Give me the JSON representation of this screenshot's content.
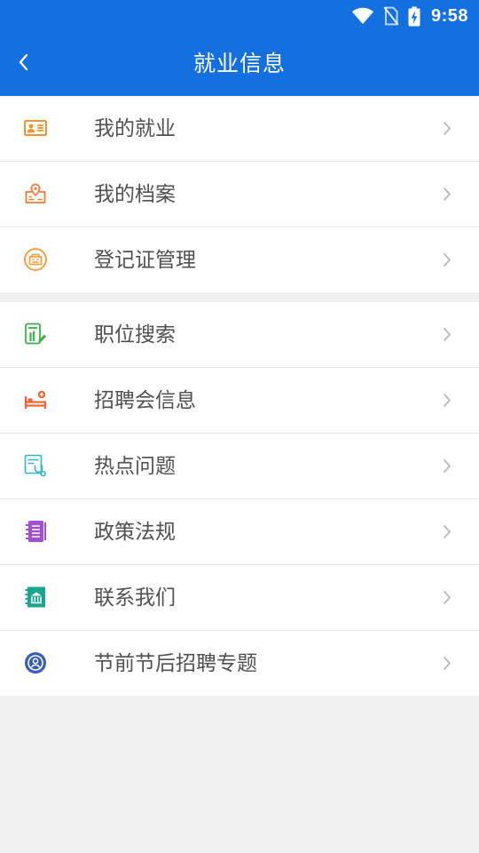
{
  "status_bar": {
    "time": "9:58",
    "icons": [
      "wifi-icon",
      "no-sim-icon",
      "battery-charging-icon"
    ]
  },
  "header": {
    "title": "就业信息",
    "back_icon": "chevron-left-icon"
  },
  "theme": {
    "primary": "#1470df",
    "background": "#f1f1f1",
    "text": "#505050",
    "divider": "#e7e7e7",
    "chevron": "#b9b9b9"
  },
  "groups": [
    {
      "items": [
        {
          "label": "我的就业",
          "icon": "id-card-icon",
          "icon_color": "#f0952e"
        },
        {
          "label": "我的档案",
          "icon": "archive-location-icon",
          "icon_color": "#f07a3a"
        },
        {
          "label": "登记证管理",
          "icon": "registration-certificate-icon",
          "icon_color": "#f29a38"
        }
      ]
    },
    {
      "items": [
        {
          "label": "职位搜索",
          "icon": "job-search-icon",
          "icon_color": "#3cb04a"
        },
        {
          "label": "招聘会信息",
          "icon": "job-fair-icon",
          "icon_color": "#ef6335"
        },
        {
          "label": "热点问题",
          "icon": "hot-questions-icon",
          "icon_color": "#33b5c4"
        },
        {
          "label": "政策法规",
          "icon": "policy-notebook-icon",
          "icon_color": "#a34fd1"
        },
        {
          "label": "联系我们",
          "icon": "contact-building-icon",
          "icon_color": "#1aa58f"
        },
        {
          "label": "节前节后招聘专题",
          "icon": "holiday-recruitment-icon",
          "icon_color": "#3a5bb8"
        }
      ]
    }
  ]
}
